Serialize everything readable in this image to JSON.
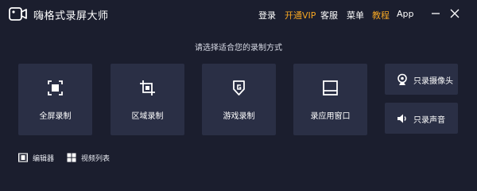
{
  "app": {
    "title": "嗨格式录屏大师"
  },
  "nav": {
    "login": "登录",
    "vip": "开通VIP",
    "service": "客服",
    "menu": "菜单",
    "tutorial": "教程",
    "app": "App"
  },
  "colors": {
    "accent": "#f5a623",
    "background": "#1b1e2e",
    "card": "#2a2f45"
  },
  "prompt": "请选择适合您的录制方式",
  "modes": [
    {
      "label": "全屏录制",
      "icon": "fullscreen-icon"
    },
    {
      "label": "区域录制",
      "icon": "crop-region-icon"
    },
    {
      "label": "游戏录制",
      "icon": "game-shield-icon"
    },
    {
      "label": "录应用窗口",
      "icon": "app-window-icon"
    }
  ],
  "side": [
    {
      "label": "只录摄像头",
      "icon": "webcam-icon"
    },
    {
      "label": "只录声音",
      "icon": "speaker-icon"
    }
  ],
  "bottom": [
    {
      "label": "编辑器",
      "icon": "film-editor-icon"
    },
    {
      "label": "视频列表",
      "icon": "grid-list-icon"
    }
  ]
}
